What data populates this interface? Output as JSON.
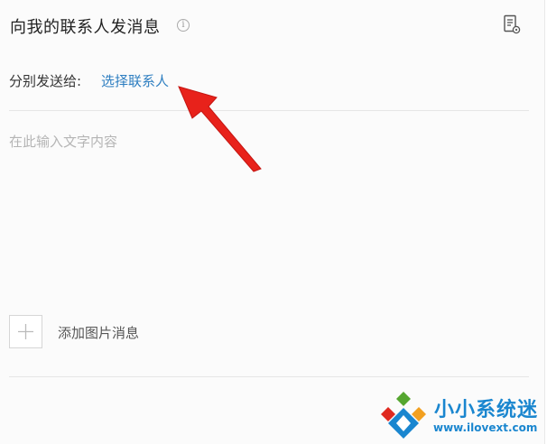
{
  "header": {
    "title": "向我的联系人发消息",
    "info_icon_glyph": "i"
  },
  "recipients": {
    "label": "分别发送给:",
    "link_text": "选择联系人"
  },
  "message": {
    "placeholder": "在此输入文字内容",
    "value": ""
  },
  "attachment": {
    "add_image_label": "添加图片消息"
  },
  "watermark": {
    "name": "小小系统迷",
    "url": "www.ilovext.com"
  },
  "colors": {
    "link": "#2f7fc1",
    "annotation_arrow": "#e8221b",
    "watermark_blue": "#1a86cf",
    "watermark_green": "#55a630",
    "watermark_red": "#e02a20"
  },
  "icons": [
    "info-icon",
    "document-settings-icon",
    "plus-icon",
    "annotation-arrow",
    "watermark-logo-icon"
  ]
}
